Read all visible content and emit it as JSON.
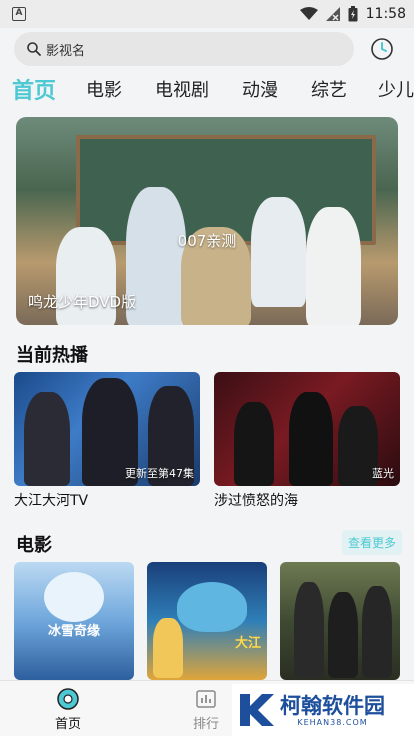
{
  "status_bar": {
    "time": "11:58",
    "left_icon": "A"
  },
  "search": {
    "placeholder": "影视名",
    "icon": "search-icon"
  },
  "history_icon": "history-clock-icon",
  "tabs": [
    {
      "label": "首页",
      "active": true
    },
    {
      "label": "电影",
      "active": false
    },
    {
      "label": "电视剧",
      "active": false
    },
    {
      "label": "动漫",
      "active": false
    },
    {
      "label": "综艺",
      "active": false
    },
    {
      "label": "少儿",
      "active": false
    }
  ],
  "banner": {
    "caption": "007亲测",
    "title": "鸣龙少年DVD版"
  },
  "hot_section": {
    "title": "当前热播",
    "items": [
      {
        "name": "大江大河TV",
        "badge": "更新至第47集"
      },
      {
        "name": "涉过愤怒的海",
        "badge": "蓝光"
      }
    ]
  },
  "movie_section": {
    "title": "电影",
    "more_label": "查看更多",
    "posters": [
      {
        "poster_text": "冰雪奇缘"
      },
      {
        "poster_text": "大江"
      },
      {
        "poster_text": ""
      }
    ]
  },
  "bottom_nav": [
    {
      "label": "首页",
      "active": true,
      "icon": "home-icon"
    },
    {
      "label": "排行",
      "active": false,
      "icon": "ranking-icon"
    }
  ],
  "watermark": {
    "main": "柯翰软件园",
    "sub": "KEHAN38.COM"
  },
  "colors": {
    "accent": "#4ec9d3",
    "text": "#111111",
    "background": "#f3f4f6"
  }
}
